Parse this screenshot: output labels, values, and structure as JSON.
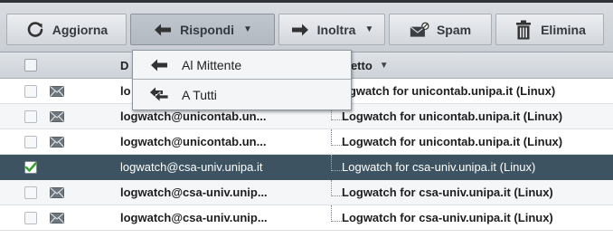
{
  "toolbar": {
    "refresh_label": "Aggiorna",
    "reply_label": "Rispondi",
    "forward_label": "Inoltra",
    "spam_label": "Spam",
    "delete_label": "Elimina",
    "dropdown_caret": "▼"
  },
  "reply_menu": {
    "items": [
      {
        "label": "Al Mittente",
        "icon": "arrow-left-icon"
      },
      {
        "label": "A Tutti",
        "icon": "reply-all-icon"
      }
    ]
  },
  "grid": {
    "header": {
      "from_label": "D",
      "subject_label": "getto",
      "sort_indicator": "▼"
    },
    "rows": [
      {
        "from": "lo",
        "subject": "ogwatch for unicontab.unipa.it (Linux)",
        "selected": false,
        "checked": false,
        "unread": true
      },
      {
        "from": "logwatch@unicontab.un...",
        "subject": "Logwatch for unicontab.unipa.it (Linux)",
        "selected": false,
        "checked": false,
        "unread": true
      },
      {
        "from": "logwatch@unicontab.un...",
        "subject": "Logwatch for unicontab.unipa.it (Linux)",
        "selected": false,
        "checked": false,
        "unread": true
      },
      {
        "from": "logwatch@csa-univ.unipa.it",
        "subject": "Logwatch for csa-univ.unipa.it (Linux)",
        "selected": true,
        "checked": true,
        "unread": false
      },
      {
        "from": "logwatch@csa-univ.unip...",
        "subject": "Logwatch for csa-univ.unipa.it (Linux)",
        "selected": false,
        "checked": false,
        "unread": true
      },
      {
        "from": "logwatch@csa-univ.unip...",
        "subject": "Logwatch for csa-univ.unipa.it (Linux)",
        "selected": false,
        "checked": false,
        "unread": true
      }
    ]
  },
  "colors": {
    "selected_row": "#3d5361",
    "checkmark": "#3aa332",
    "toolbar_bg": "#d3d7dc"
  }
}
